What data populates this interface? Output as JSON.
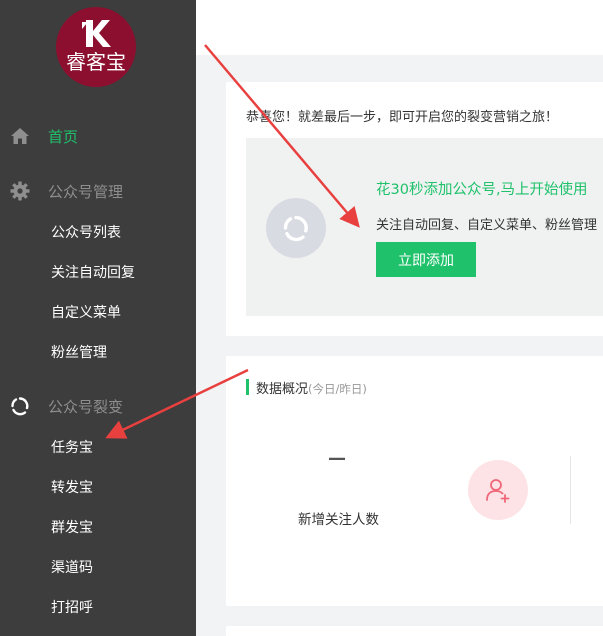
{
  "sidebar": {
    "logo": {
      "text": "睿客宝",
      "mark": "K",
      "color": "#8c0f2f"
    },
    "home": {
      "label": "首页",
      "icon": "home-icon"
    },
    "groups": [
      {
        "label": "公众号管理",
        "icon": "gear-icon",
        "items": [
          "公众号列表",
          "关注自动回复",
          "自定义菜单",
          "粉丝管理"
        ]
      },
      {
        "label": "公众号裂变",
        "icon": "fission-icon",
        "items": [
          "任务宝",
          "转发宝",
          "群发宝",
          "渠道码",
          "打招呼"
        ]
      }
    ]
  },
  "main": {
    "congrats": "恭喜您！就差最后一步，即可开启您的裂变营销之旅！",
    "promo": {
      "title": "花30秒添加公众号,马上开始使用",
      "desc": "关注自动回复、自定义菜单、粉丝管理",
      "button": "立即添加"
    },
    "overview": {
      "title": "数据概况",
      "subtitle": "(今日/昨日)",
      "stat_value": "—",
      "stat_label": "新增关注人数",
      "stat_icon": "add-user-icon"
    }
  },
  "colors": {
    "sidebar_bg": "#3d3d3d",
    "accent_green": "#1fc16b",
    "annotation_red": "#e8403f"
  }
}
